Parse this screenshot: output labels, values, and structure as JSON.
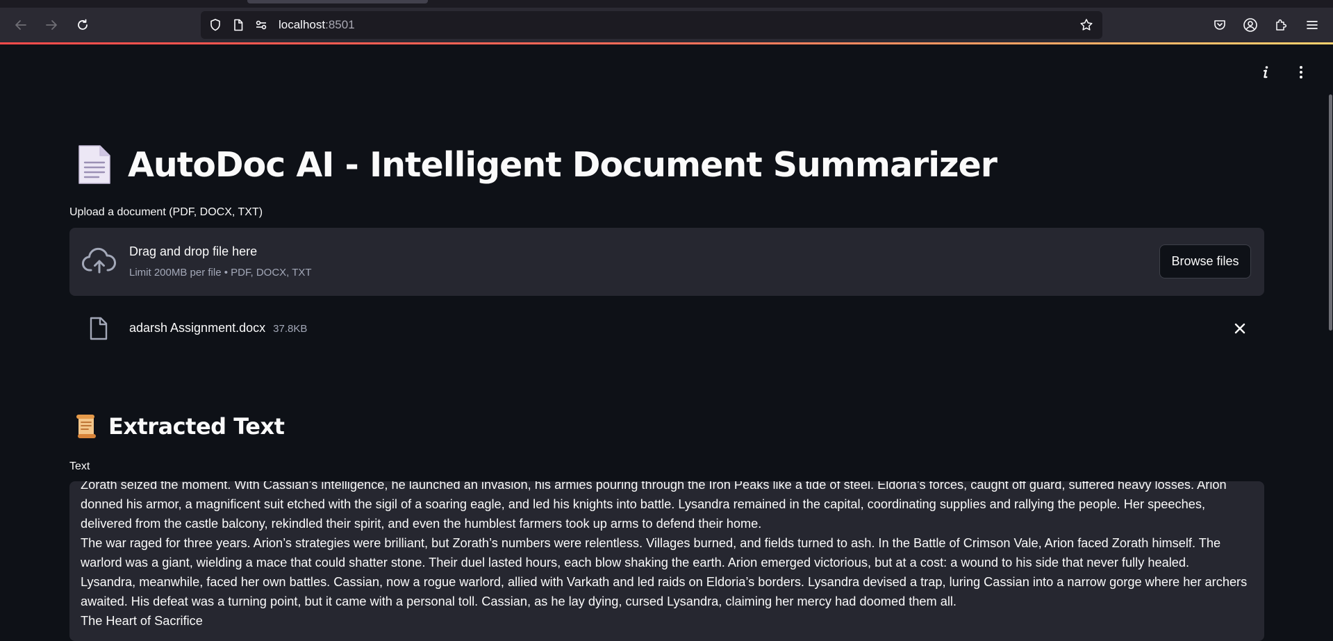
{
  "browser": {
    "url_host": "localhost",
    "url_port": ":8501"
  },
  "app": {
    "title_emoji": "📄",
    "title": "AutoDoc AI - Intelligent Document Summarizer",
    "uploader": {
      "label": "Upload a document (PDF, DOCX, TXT)",
      "drop_title": "Drag and drop file here",
      "drop_subtitle": "Limit 200MB per file • PDF, DOCX, TXT",
      "browse_label": "Browse files"
    },
    "uploaded_file": {
      "name": "adarsh Assignment.docx",
      "size": "37.8KB"
    },
    "extracted": {
      "emoji": "📜",
      "heading": "Extracted Text",
      "textarea_label": "Text",
      "paragraphs": [
        "Zorath seized the moment. With Cassian’s intelligence, he launched an invasion, his armies pouring through the Iron Peaks like a tide of steel. Eldoria’s forces, caught off guard, suffered heavy losses. Arion donned his armor, a magnificent suit etched with the sigil of a soaring eagle, and led his knights into battle. Lysandra remained in the capital, coordinating supplies and rallying the people. Her speeches, delivered from the castle balcony, rekindled their spirit, and even the humblest farmers took up arms to defend their home.",
        "The war raged for three years. Arion’s strategies were brilliant, but Zorath’s numbers were relentless. Villages burned, and fields turned to ash. In the Battle of Crimson Vale, Arion faced Zorath himself. The warlord was a giant, wielding a mace that could shatter stone. Their duel lasted hours, each blow shaking the earth. Arion emerged victorious, but at a cost: a wound to his side that never fully healed.",
        "Lysandra, meanwhile, faced her own battles. Cassian, now a rogue warlord, allied with Varkath and led raids on Eldoria’s borders. Lysandra devised a trap, luring Cassian into a narrow gorge where her archers awaited. His defeat was a turning point, but it came with a personal toll. Cassian, as he lay dying, cursed Lysandra, claiming her mercy had doomed them all.",
        "The Heart of Sacrifice"
      ]
    }
  },
  "colors": {
    "app_bg": "#0e1117",
    "widget_bg": "#262730",
    "browser_bar": "#2b2a33",
    "accent": "#ff4b4b"
  }
}
